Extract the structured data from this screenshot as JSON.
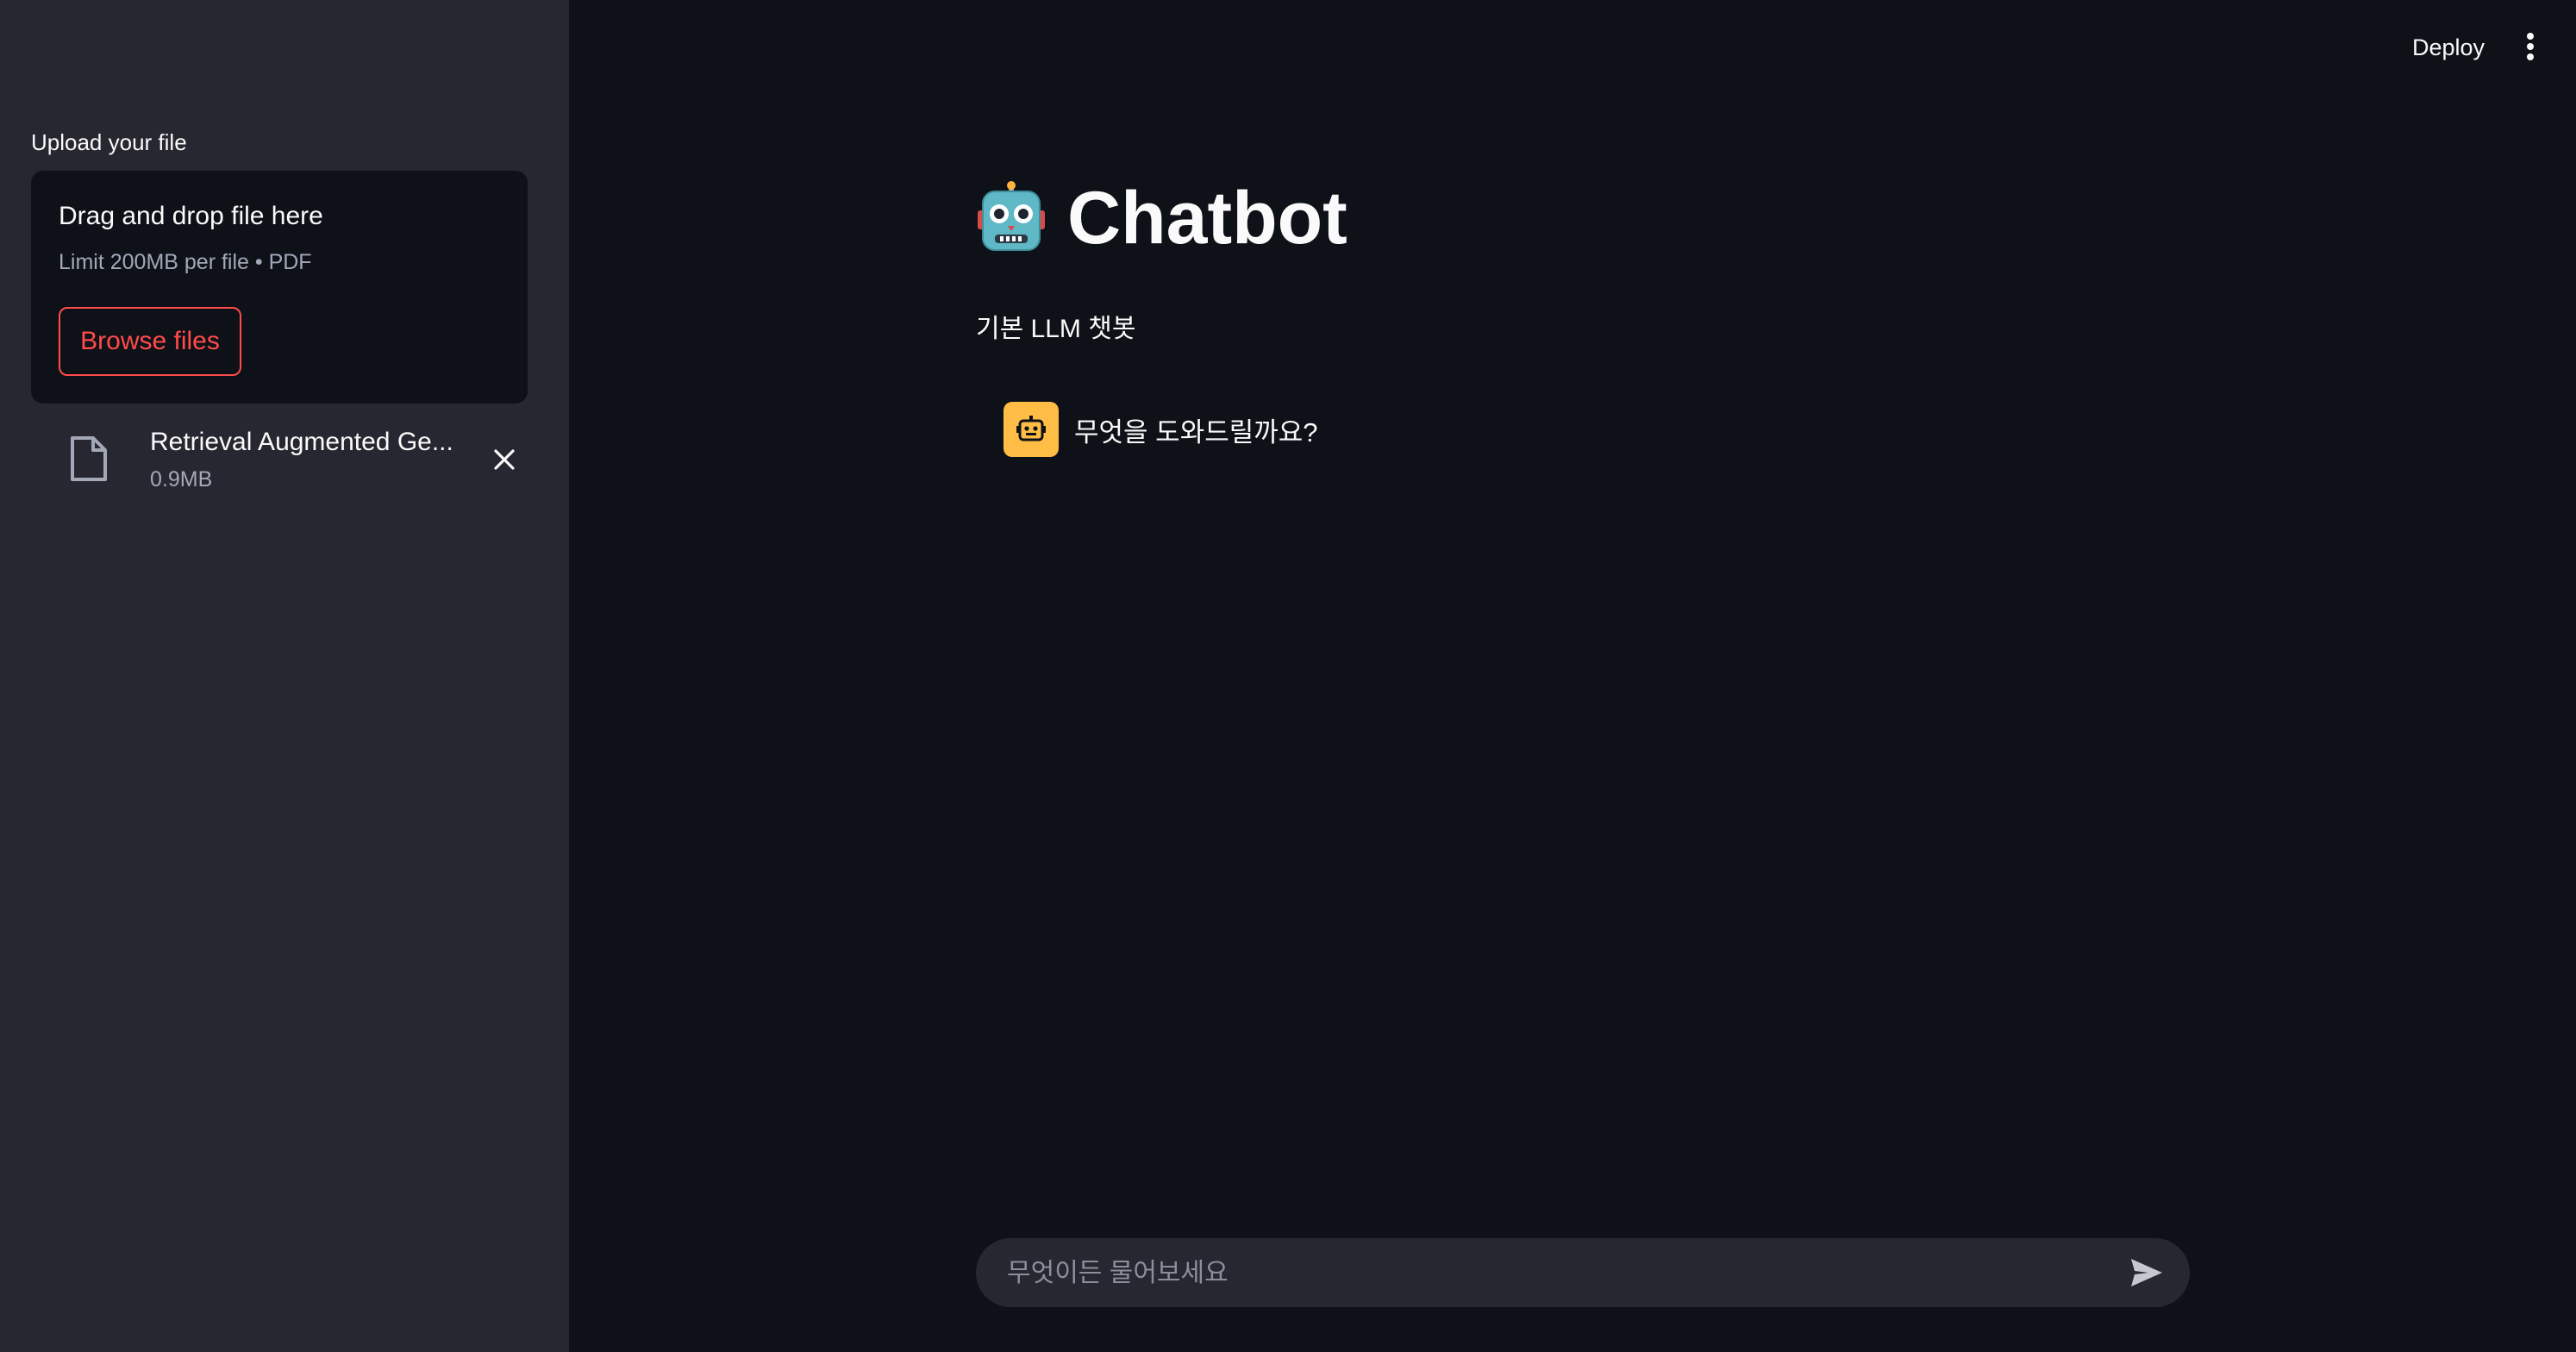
{
  "sidebar": {
    "upload_label": "Upload your file",
    "dropzone": {
      "title": "Drag and drop file here",
      "limit_text": "Limit 200MB per file • PDF",
      "browse_label": "Browse files"
    },
    "uploaded_file": {
      "name": "Retrieval Augmented Ge...",
      "size": "0.9MB",
      "icon": "file-icon"
    }
  },
  "header": {
    "deploy_label": "Deploy",
    "menu_icon": "vertical-dots-icon"
  },
  "main": {
    "title_emoji": "robot-emoji",
    "title": "Chatbot",
    "subtitle": "기본 LLM 챗봇",
    "messages": [
      {
        "role": "assistant",
        "avatar": "robot-icon",
        "text": "무엇을 도와드릴까요?"
      }
    ]
  },
  "chat_input": {
    "placeholder": "무엇이든 물어보세요",
    "value": "",
    "send_icon": "send-icon"
  },
  "colors": {
    "app_bg": "#0e1117",
    "sidebar_bg": "#262730",
    "accent": "#ff4b4b",
    "avatar_bg": "#ffbd45",
    "muted_text": "#a3a8b8"
  }
}
